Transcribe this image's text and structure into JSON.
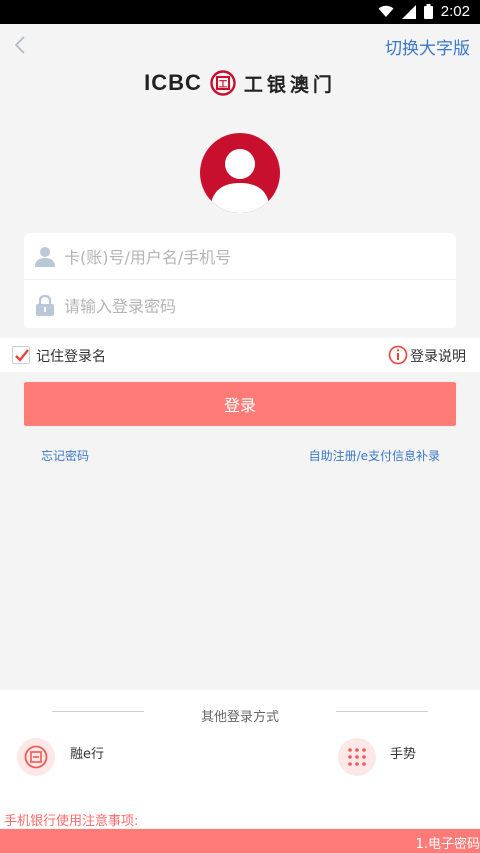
{
  "status_bar": {
    "time": "2:02"
  },
  "topbar": {
    "switch_label": "切换大字版"
  },
  "brand": {
    "name_en": "ICBC",
    "emblem_text": "工",
    "name_cn": "工银澳门"
  },
  "form": {
    "account_placeholder": "卡(账)号/用户名/手机号",
    "password_placeholder": "请输入登录密码"
  },
  "remember": {
    "label": "记住登录名",
    "checked": true
  },
  "help": {
    "label": "登录说明"
  },
  "login_button": "登录",
  "links": {
    "forgot": "忘记密码",
    "self_register": "自助注册/e支付信息补录"
  },
  "other_login": {
    "title": "其他登录方式",
    "options": [
      {
        "label": "融e行",
        "icon": "rong-e-icon"
      },
      {
        "label": "手势",
        "icon": "gesture-grid-icon"
      }
    ]
  },
  "notice": {
    "title": "手机银行使用注意事项:",
    "first_item": "1.电子密码"
  },
  "colors": {
    "brand_red": "#c8102e",
    "button": "#ff7b78",
    "link": "#3b78c9"
  }
}
